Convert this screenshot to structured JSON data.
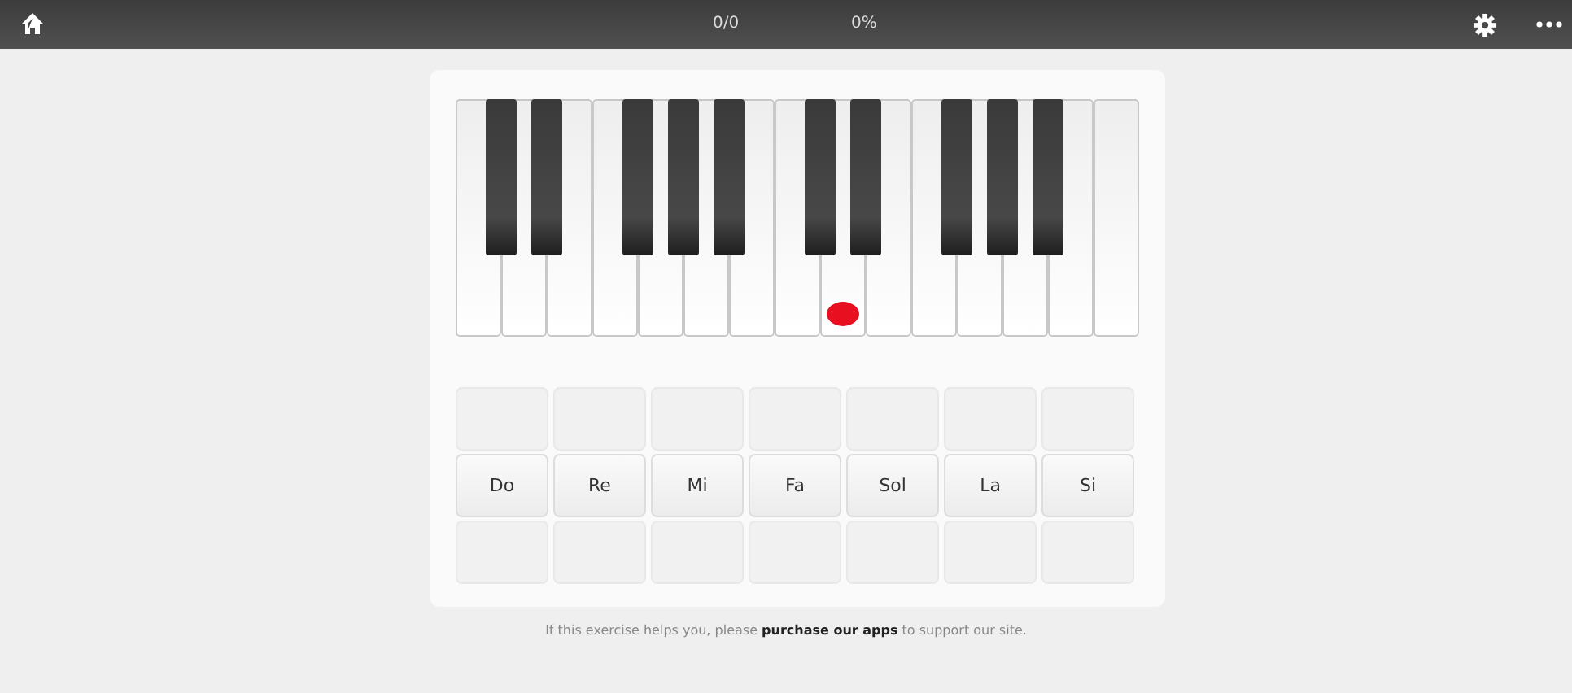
{
  "top_bar": {
    "score": "0/0",
    "percent": "0%"
  },
  "keyboard": {
    "white_keys": [
      {
        "marked": false
      },
      {
        "marked": false
      },
      {
        "marked": false
      },
      {
        "marked": false
      },
      {
        "marked": false
      },
      {
        "marked": false
      },
      {
        "marked": false
      },
      {
        "marked": false
      },
      {
        "marked": true
      },
      {
        "marked": false
      },
      {
        "marked": false
      },
      {
        "marked": false
      },
      {
        "marked": false
      },
      {
        "marked": false
      },
      {
        "marked": false
      }
    ]
  },
  "answers": [
    "Do",
    "Re",
    "Mi",
    "Fa",
    "Sol",
    "La",
    "Si"
  ],
  "footer": {
    "before": "If this exercise helps you, please",
    "link": "purchase our apps",
    "after": "to support our site."
  }
}
